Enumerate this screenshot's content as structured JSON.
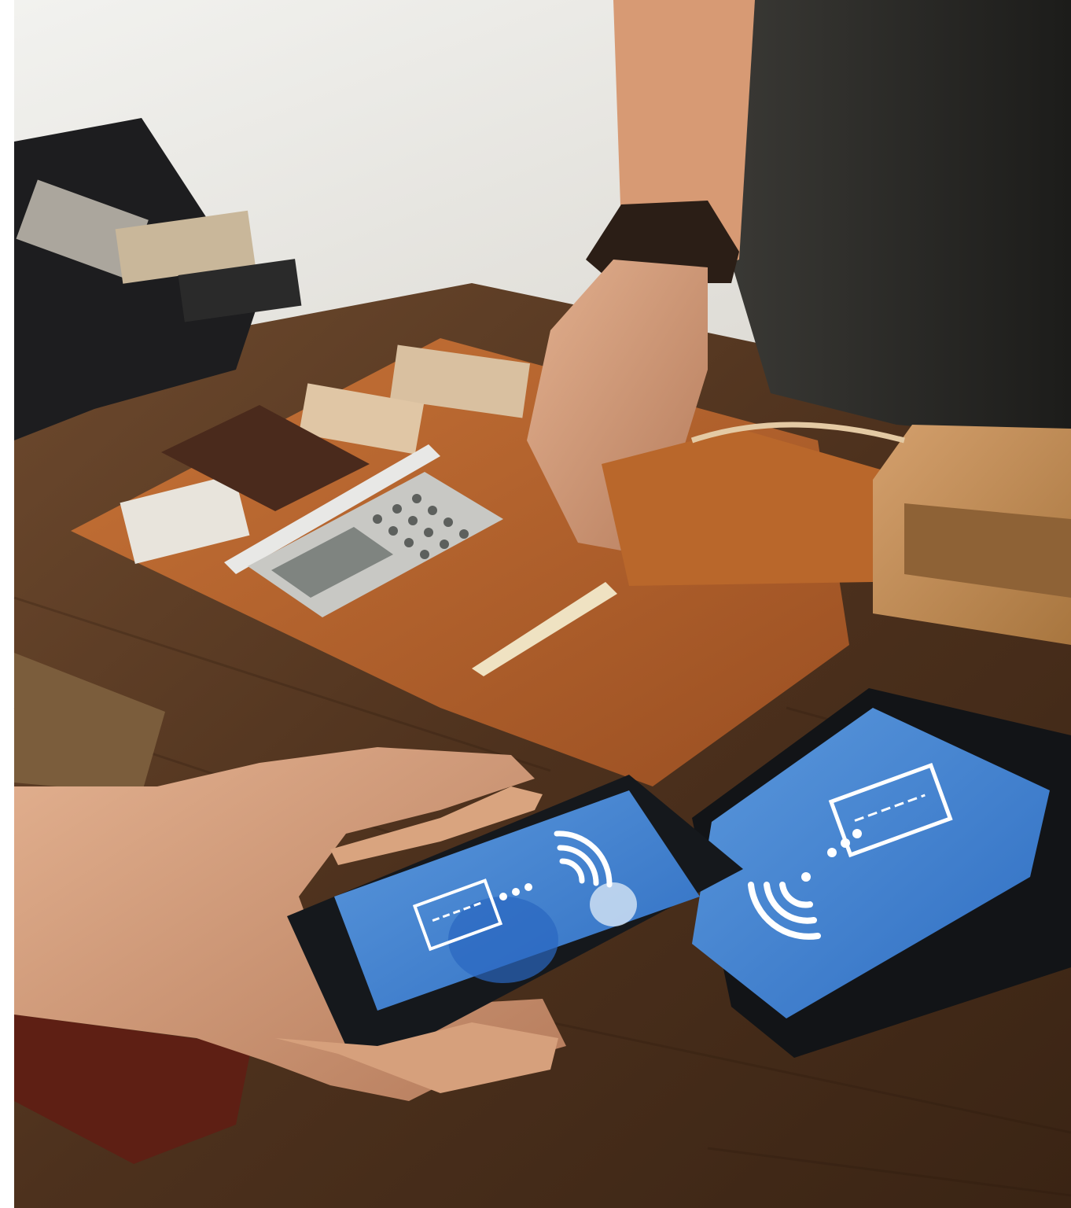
{
  "scene": {
    "description_colors": {
      "wall": "#e9e8e4",
      "counter_wood": "#5a3a22",
      "leather_mat": "#b8652e",
      "screen_blue": "#3f7fd0",
      "phone_black": "#111418"
    },
    "phone_left": {
      "screen_icons": [
        "credit-card-icon",
        "dots-icon",
        "contactless-icon"
      ]
    },
    "phone_right": {
      "screen_icons": [
        "credit-card-icon",
        "dots-icon",
        "contactless-icon"
      ]
    }
  }
}
